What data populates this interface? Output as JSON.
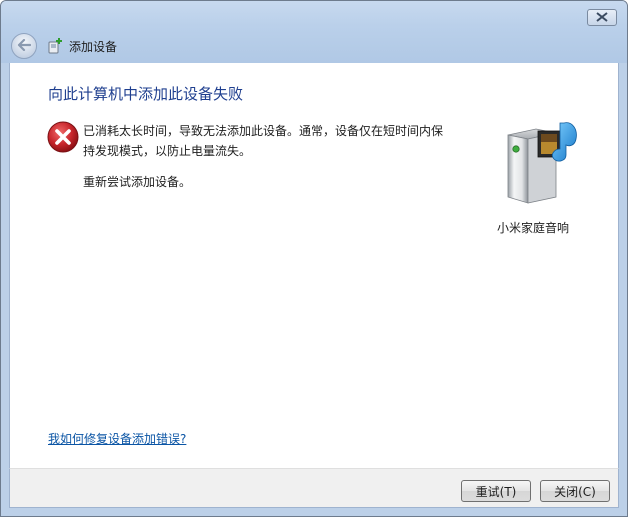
{
  "window": {
    "title": "添加设备",
    "close_glyph": "✕",
    "back_icon": "back-arrow-icon",
    "title_icon": "add-device-icon"
  },
  "main": {
    "heading": "向此计算机中添加此设备失败",
    "error_icon": "error-icon",
    "message": "已消耗太长时间，导致无法添加此设备。通常，设备仅在短时间内保持发现模式，以防止电量流失。",
    "retry_text": "重新尝试添加设备。",
    "help_link": "我如何修复设备添加错误?"
  },
  "device": {
    "icon": "media-device-icon",
    "name": "小米家庭音响"
  },
  "footer": {
    "retry_button": "重试(T)",
    "close_button": "关闭(C)"
  },
  "colors": {
    "heading": "#1f3f8f",
    "link": "#0b55a5",
    "error_red": "#c8262c",
    "frame": "#bcd0e8"
  }
}
